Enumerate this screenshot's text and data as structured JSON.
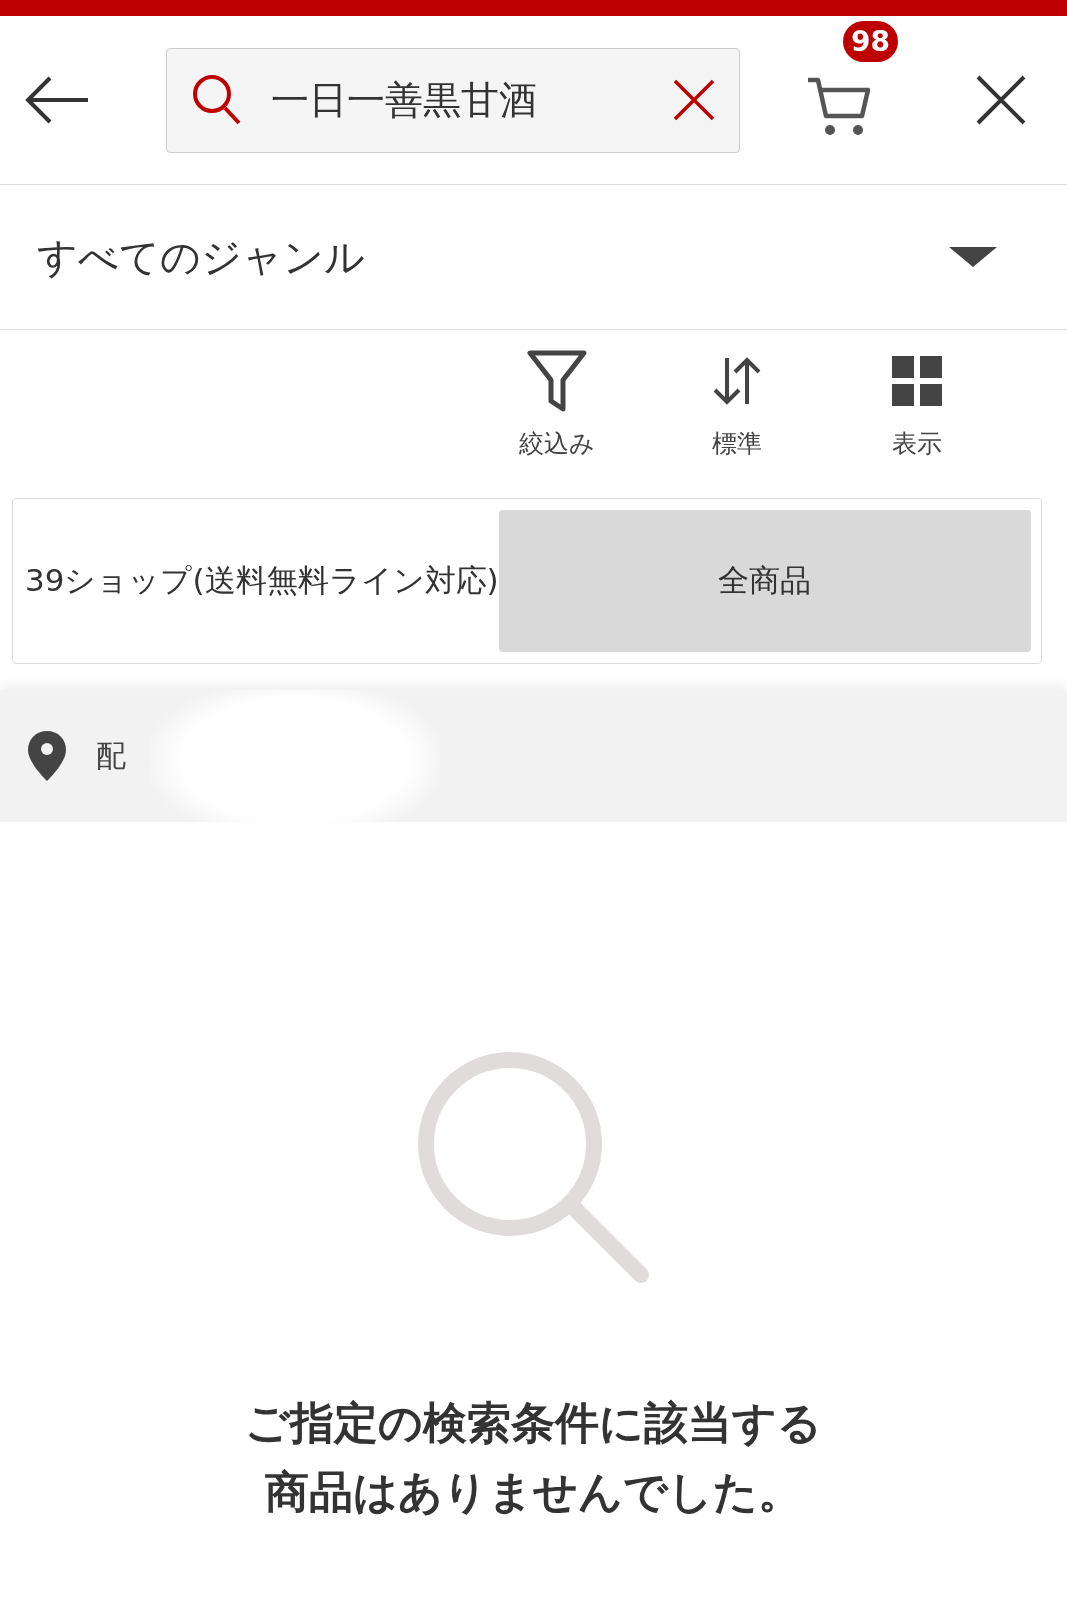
{
  "header": {
    "search": {
      "value": "一日一善黒甘酒"
    },
    "cart": {
      "badge": "98"
    }
  },
  "genre": {
    "label": "すべてのジャンル"
  },
  "toolbar": [
    {
      "kind": "filter",
      "label": "絞込み"
    },
    {
      "kind": "sort",
      "label": "標準"
    },
    {
      "kind": "view",
      "label": "表示"
    }
  ],
  "shop_filter": [
    {
      "label": "39ショップ(送料無料ライン対応)",
      "selected": false
    },
    {
      "label": "全商品",
      "selected": true
    }
  ],
  "delivery": {
    "label": "配"
  },
  "empty_state": {
    "lines": [
      "ご指定の検索条件に該当する",
      "商品はありませんでした。"
    ]
  }
}
